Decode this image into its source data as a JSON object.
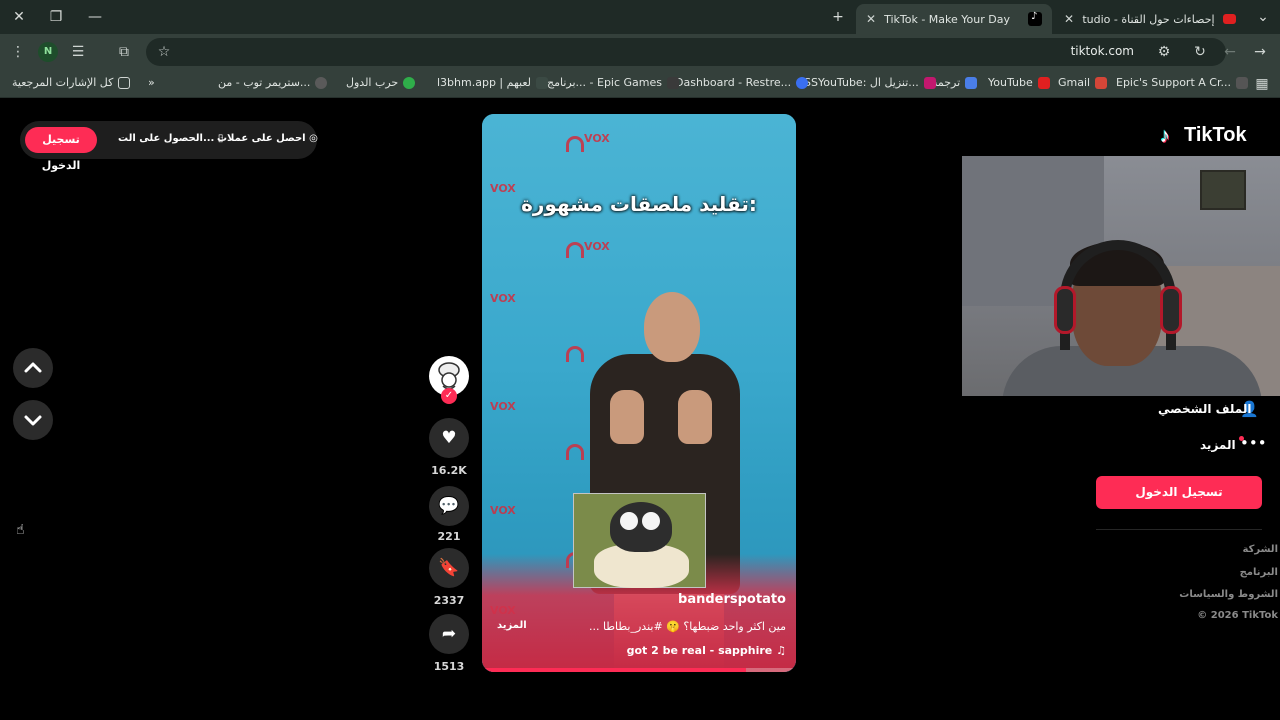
{
  "browser": {
    "tabs": [
      {
        "label": "إحصاءات حول القناة - YouTube Studio",
        "active": false
      },
      {
        "label": "TikTok - Make Your Day",
        "active": true
      }
    ],
    "url": "tiktok.com",
    "bookmarks": [
      "Epic's Support A Cr...",
      "Gmail",
      "YouTube",
      "ترجمة",
      "SSYouTube: تنزيل ال...",
      "Dashboard - Restre...",
      "برنامج... - Epic Games",
      "l3bhm.app | لعبهم",
      "حرب الدول",
      "ستريمر توب - من...",
      "»",
      "كل الإشارات المرجعية"
    ],
    "profile_initial": "N"
  },
  "tiktok": {
    "top_pill": {
      "login": "تسجيل الدخول",
      "get_app": "الحصول على الت...",
      "get_coins": "احصل على عملات"
    },
    "logo": "TikTok",
    "video": {
      "overlay_title": "تقليد ملصقات مشهورة:",
      "username": "banderspotato",
      "caption": "مين اكثر واحد ضبطها؟ 🤫 #بندر_بطاطا ...",
      "more": "المزيد",
      "music": "got 2 be real - sapphire",
      "progress_percent": 84
    },
    "actions": {
      "likes": "16.2K",
      "comments": "221",
      "saves": "2337",
      "shares": "1513"
    },
    "sidebar": {
      "profile": "الملف الشخصي",
      "more": "المزيد",
      "login": "تسجيل الدخول",
      "footer": [
        "الشركة",
        "البرنامج",
        "الشروط والسياسات",
        "© 2026 TikTok"
      ]
    }
  }
}
